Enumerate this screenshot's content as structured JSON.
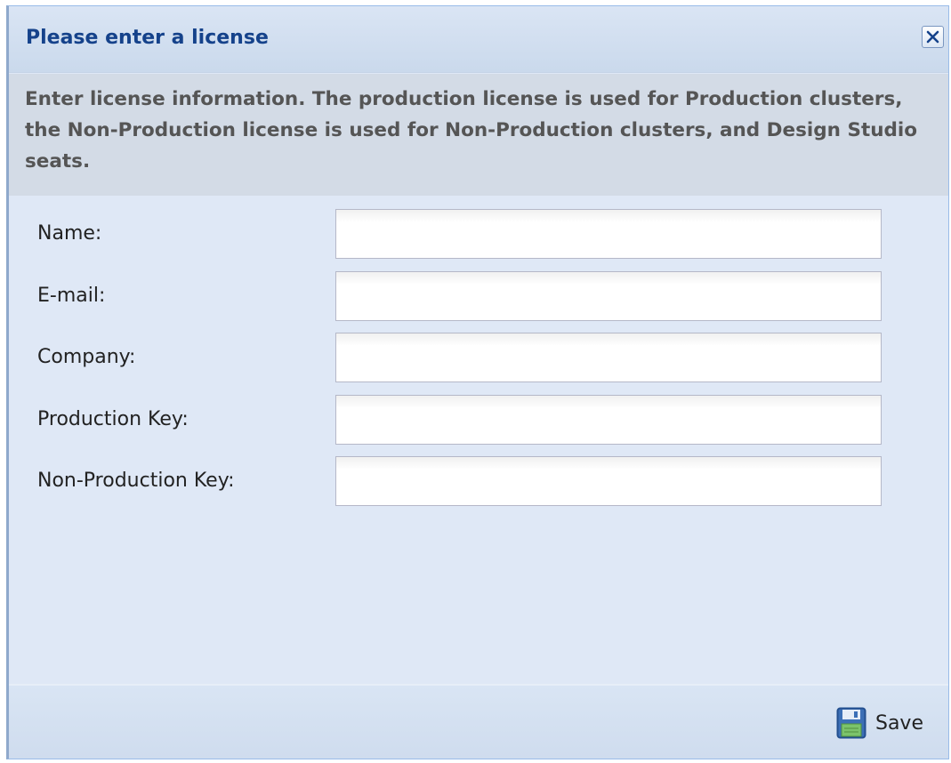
{
  "dialog": {
    "title": "Please enter a license",
    "intro": "Enter license information. The production license is used for Production clusters, the Non-Production license is used for Non-Production clusters, and Design Studio seats."
  },
  "form": {
    "fields": [
      {
        "label": "Name:",
        "value": ""
      },
      {
        "label": "E-mail:",
        "value": ""
      },
      {
        "label": "Company:",
        "value": ""
      },
      {
        "label": "Production Key:",
        "value": ""
      },
      {
        "label": "Non-Production Key:",
        "value": ""
      }
    ]
  },
  "footer": {
    "save_label": "Save",
    "save_icon": "floppy-disk-icon"
  },
  "icons": {
    "close": "close-icon"
  },
  "colors": {
    "title": "#15428b",
    "dialog_bg": "#dfe8f6",
    "intro_bg": "#d3dbe6",
    "border": "#99bbe8"
  }
}
